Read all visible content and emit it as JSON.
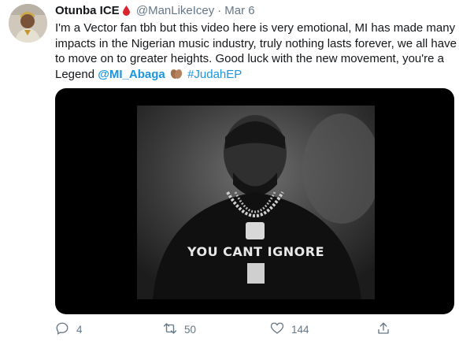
{
  "tweet": {
    "author_name": "Otunba ICE",
    "handle": "@ManLikeIcey",
    "separator": "·",
    "date": "Mar 6",
    "text_part1": "I'm a Vector fan tbh but this video here is very emotional, MI has made many impacts in the Nigerian music industry, truly nothing lasts forever, we all have to move on to greater heights. Good luck with the new movement, you're a Legend",
    "mention": "@MI_Abaga",
    "hashtag": "#JudahEP"
  },
  "media": {
    "shirt_text": "YOU CANT IGNORE"
  },
  "actions": {
    "reply_count": "4",
    "retweet_count": "50",
    "like_count": "144"
  },
  "colors": {
    "accent": "#1b95e0",
    "secondary_text": "#657786",
    "drop_red": "#d9262e"
  }
}
